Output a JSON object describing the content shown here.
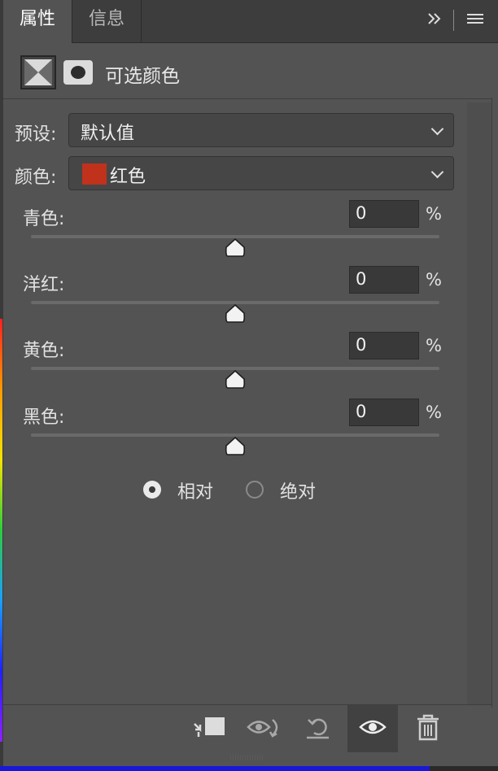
{
  "tabs": [
    {
      "label": "属性",
      "active": true
    },
    {
      "label": "信息",
      "active": false
    }
  ],
  "header_icons": [
    "collapse-double-chevron-icon",
    "panel-menu-icon"
  ],
  "title": "可选颜色",
  "preset": {
    "label": "预设:",
    "value": "默认值"
  },
  "color": {
    "label": "颜色:",
    "value": "红色",
    "swatch": "#c0321b"
  },
  "sliders": [
    {
      "label": "青色:",
      "value": "0",
      "unit": "%",
      "level": 0.5
    },
    {
      "label": "洋红:",
      "value": "0",
      "unit": "%",
      "level": 0.5
    },
    {
      "label": "黄色:",
      "value": "0",
      "unit": "%",
      "level": 0.5
    },
    {
      "label": "黑色:",
      "value": "0",
      "unit": "%",
      "level": 0.5
    }
  ],
  "method": {
    "options": [
      "相对",
      "绝对"
    ],
    "selected": "相对"
  },
  "footer_icons": [
    "clip-to-layer-icon",
    "view-previous-state-icon",
    "reset-icon",
    "visibility-eye-icon",
    "trash-icon"
  ],
  "colors": {
    "panel_bg": "#535353",
    "tabbar_bg": "#3d3d3d",
    "field_bg": "#464646"
  }
}
